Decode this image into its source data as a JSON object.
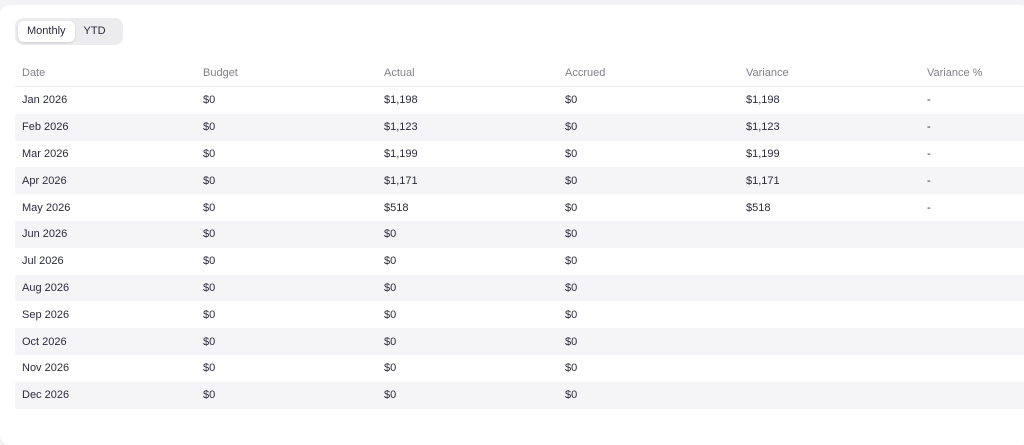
{
  "view_toggle": {
    "options": [
      "Monthly",
      "YTD"
    ],
    "selected": "Monthly"
  },
  "table": {
    "headers": [
      "Date",
      "Budget",
      "Actual",
      "Accrued",
      "Variance",
      "Variance %"
    ],
    "rows": [
      [
        "Jan 2026",
        "$0",
        "$1,198",
        "$0",
        "$1,198",
        "-"
      ],
      [
        "Feb 2026",
        "$0",
        "$1,123",
        "$0",
        "$1,123",
        "-"
      ],
      [
        "Mar 2026",
        "$0",
        "$1,199",
        "$0",
        "$1,199",
        "-"
      ],
      [
        "Apr 2026",
        "$0",
        "$1,171",
        "$0",
        "$1,171",
        "-"
      ],
      [
        "May 2026",
        "$0",
        "$518",
        "$0",
        "$518",
        "-"
      ],
      [
        "Jun 2026",
        "$0",
        "$0",
        "$0",
        "",
        ""
      ],
      [
        "Jul 2026",
        "$0",
        "$0",
        "$0",
        "",
        ""
      ],
      [
        "Aug 2026",
        "$0",
        "$0",
        "$0",
        "",
        ""
      ],
      [
        "Sep 2026",
        "$0",
        "$0",
        "$0",
        "",
        ""
      ],
      [
        "Oct 2026",
        "$0",
        "$0",
        "$0",
        "",
        ""
      ],
      [
        "Nov 2026",
        "$0",
        "$0",
        "$0",
        "",
        ""
      ],
      [
        "Dec 2026",
        "$0",
        "$0",
        "$0",
        "",
        ""
      ]
    ]
  },
  "colors": {
    "page_bg": "#f3f3f5",
    "card_bg": "#ffffff",
    "row_stripe": "#f5f5f7",
    "header_text": "#80808c",
    "body_text": "#2b2b3a"
  }
}
